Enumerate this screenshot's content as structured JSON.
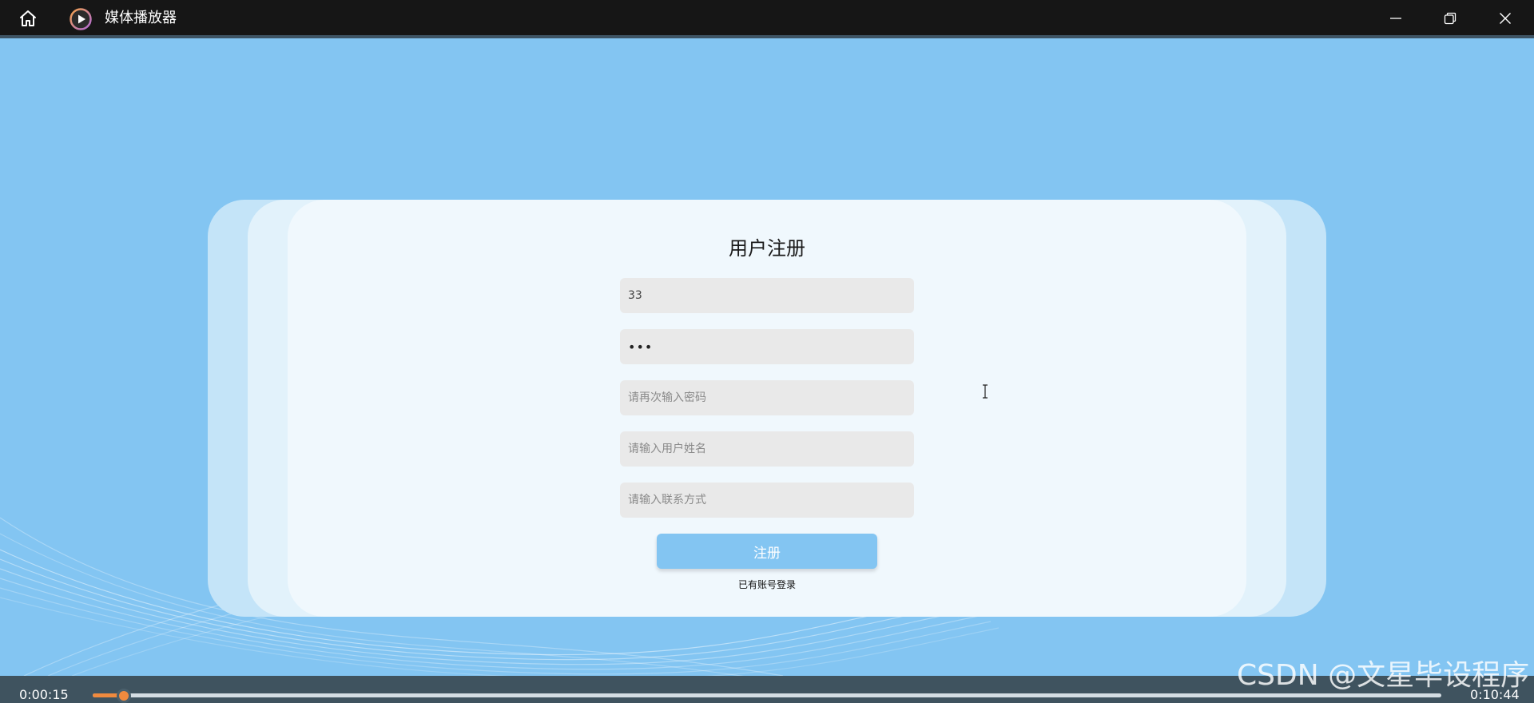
{
  "titlebar": {
    "app_title": "媒体播放器",
    "home_icon": "home-icon",
    "logo_icon": "play-circle-icon",
    "controls": [
      "minimize-icon",
      "restore-icon",
      "close-icon"
    ]
  },
  "form": {
    "title": "用户注册",
    "username_value": "33",
    "password_value": "•••",
    "confirm_password_placeholder": "请再次输入密码",
    "real_name_placeholder": "请输入用户姓名",
    "contact_placeholder": "请输入联系方式",
    "submit_label": "注册",
    "login_link": "已有账号登录"
  },
  "player": {
    "elapsed": "0:00:15",
    "total": "0:10:44",
    "progress_fraction": 0.0233
  },
  "watermark": "CSDN @文星毕设程序",
  "colors": {
    "background": "#83c5f2",
    "accent": "#f08a3e",
    "titlebar": "#161616",
    "player_bar": "#3f535f"
  }
}
